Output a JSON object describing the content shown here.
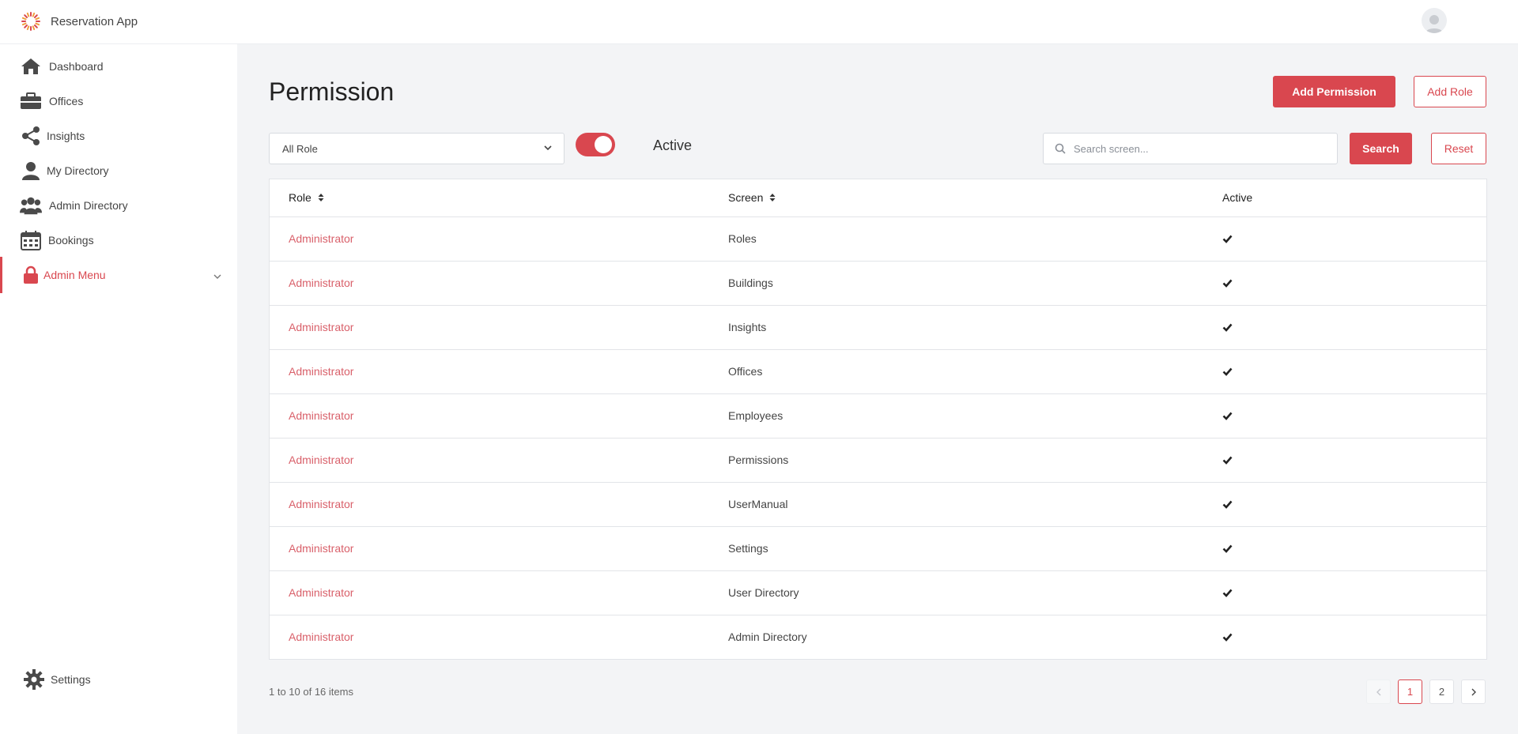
{
  "app": {
    "title": "Reservation App"
  },
  "sidebar": {
    "items": [
      {
        "label": "Dashboard",
        "icon": "home-icon"
      },
      {
        "label": "Offices",
        "icon": "briefcase-icon"
      },
      {
        "label": "Insights",
        "icon": "share-icon"
      },
      {
        "label": "My Directory",
        "icon": "user-icon"
      },
      {
        "label": "Admin Directory",
        "icon": "users-icon"
      },
      {
        "label": "Bookings",
        "icon": "calendar-icon"
      },
      {
        "label": "Admin Menu",
        "icon": "lock-icon",
        "active": true,
        "expandable": true
      }
    ],
    "settings_label": "Settings"
  },
  "page": {
    "title": "Permission",
    "add_permission_label": "Add Permission",
    "add_role_label": "Add Role"
  },
  "filters": {
    "role_select_value": "All Role",
    "active_toggle_on": true,
    "active_label": "Active",
    "search_placeholder": "Search screen...",
    "search_value": "",
    "search_button_label": "Search",
    "reset_button_label": "Reset"
  },
  "table": {
    "columns": [
      "Role",
      "Screen",
      "Active"
    ],
    "rows": [
      {
        "role": "Administrator",
        "screen": "Roles",
        "active": true
      },
      {
        "role": "Administrator",
        "screen": "Buildings",
        "active": true
      },
      {
        "role": "Administrator",
        "screen": "Insights",
        "active": true
      },
      {
        "role": "Administrator",
        "screen": "Offices",
        "active": true
      },
      {
        "role": "Administrator",
        "screen": "Employees",
        "active": true
      },
      {
        "role": "Administrator",
        "screen": "Permissions",
        "active": true
      },
      {
        "role": "Administrator",
        "screen": "UserManual",
        "active": true
      },
      {
        "role": "Administrator",
        "screen": "Settings",
        "active": true
      },
      {
        "role": "Administrator",
        "screen": "User Directory",
        "active": true
      },
      {
        "role": "Administrator",
        "screen": "Admin Directory",
        "active": true
      }
    ]
  },
  "pagination": {
    "summary": "1 to 10 of 16 items",
    "pages": [
      "1",
      "2"
    ],
    "current_page": "1"
  },
  "colors": {
    "accent": "#d9474f",
    "link": "#d9606a",
    "background": "#f3f4f6"
  }
}
